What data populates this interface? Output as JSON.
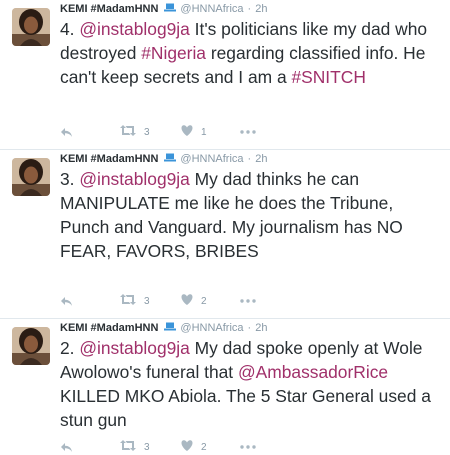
{
  "user": {
    "name": "KEMI #MadamHNN",
    "handle": "@HNNAfrica",
    "separator": "·"
  },
  "colors": {
    "link": "#a0306a",
    "muted": "#8899a6",
    "icon": "#aab8c2"
  },
  "tweets": [
    {
      "time": "2h",
      "segments": [
        {
          "t": "4. ",
          "link": false
        },
        {
          "t": "@instablog9ja",
          "link": true
        },
        {
          "t": " It's politicians like my dad who destroyed ",
          "link": false
        },
        {
          "t": "#Nigeria",
          "link": true
        },
        {
          "t": " regarding classified info. He can't keep secrets and I am a ",
          "link": false
        },
        {
          "t": "#SNITCH",
          "link": true
        }
      ],
      "retweets": "3",
      "likes": "1"
    },
    {
      "time": "2h",
      "segments": [
        {
          "t": "3. ",
          "link": false
        },
        {
          "t": "@instablog9ja",
          "link": true
        },
        {
          "t": "  My dad thinks he can MANIPULATE me like he does the Tribune, Punch and Vanguard. My journalism has NO FEAR, FAVORS, BRIBES",
          "link": false
        }
      ],
      "retweets": "3",
      "likes": "2"
    },
    {
      "time": "2h",
      "segments": [
        {
          "t": "2. ",
          "link": false
        },
        {
          "t": "@instablog9ja",
          "link": true
        },
        {
          "t": " My dad spoke openly at Wole Awolowo's funeral that ",
          "link": false
        },
        {
          "t": "@AmbassadorRice",
          "link": true
        },
        {
          "t": " KILLED MKO Abiola. The 5 Star General used a stun gun",
          "link": false
        }
      ],
      "retweets": "3",
      "likes": "2"
    }
  ],
  "icons": {
    "reply": "reply-icon",
    "retweet": "retweet-icon",
    "like": "heart-icon",
    "more": "more-icon",
    "device": "laptop-icon"
  }
}
